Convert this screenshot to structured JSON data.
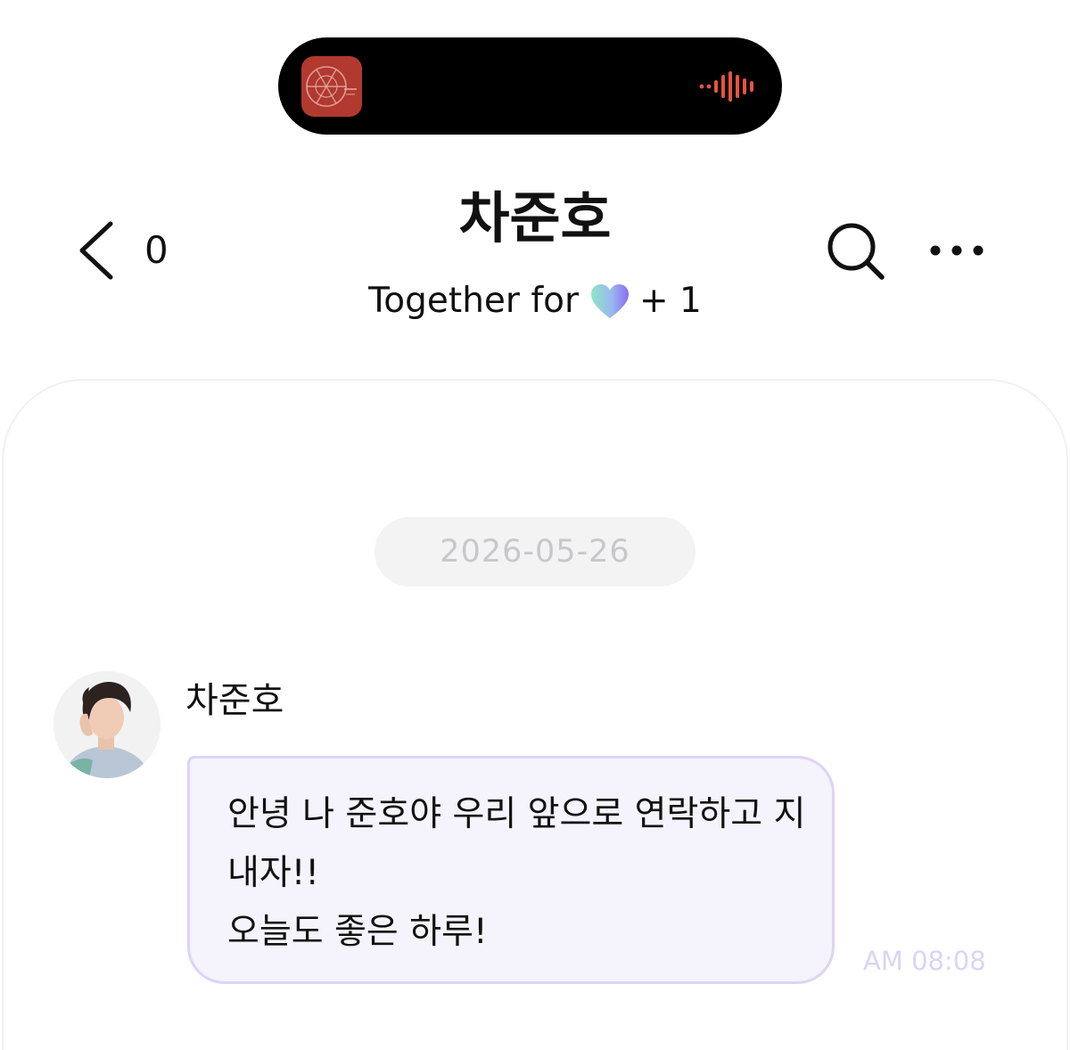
{
  "header": {
    "unread_count": "0",
    "title": "차준호",
    "subtitle_prefix": "Together for",
    "subtitle_suffix": "+ 1"
  },
  "icons": {
    "back": "chevron-left-icon",
    "search": "search-icon",
    "more": "more-horizontal-icon",
    "heart": "heart-icon",
    "album_art": "album-art",
    "audio_wave": "audio-wave-icon"
  },
  "chat": {
    "date": "2026-05-26",
    "messages": [
      {
        "sender": "차준호",
        "lines": [
          "안녕 나 준호야 우리 앞으로 연락하고 지",
          "내자!!",
          "오늘도 좋은 하루!"
        ],
        "time": "AM 08:08"
      }
    ]
  },
  "colors": {
    "bubble_background": "#f5f3fb",
    "bubble_border": "#ded3f6",
    "timestamp": "#dcd3f4",
    "date_pill_background": "#f3f3f4",
    "date_pill_text": "#c7c7cc",
    "island_album_art": "#b1392f",
    "audio_wave": "#e8533f"
  }
}
